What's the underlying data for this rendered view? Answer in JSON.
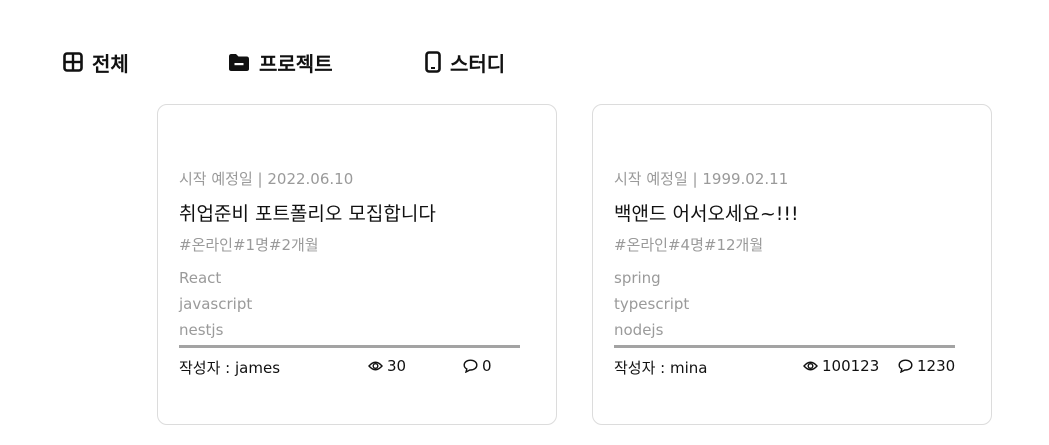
{
  "tabs": [
    {
      "label": "전체",
      "icon": "grid-icon"
    },
    {
      "label": "프로젝트",
      "icon": "folder-icon"
    },
    {
      "label": "스터디",
      "icon": "mobile-icon"
    }
  ],
  "cards": [
    {
      "date": "시작 예정일 | 2022.06.10",
      "title": "취업준비 포트폴리오 모집합니다",
      "tags": "#온라인#1명#2개월",
      "stack": [
        "React",
        "javascript",
        "nestjs"
      ],
      "author": "작성자 : james",
      "views": "30",
      "comments": "0"
    },
    {
      "date": "시작 예정일 | 1999.02.11",
      "title": "백앤드 어서오세요~!!!",
      "tags": "#온라인#4명#12개월",
      "stack": [
        "spring",
        "typescript",
        "nodejs"
      ],
      "author": "작성자 : mina",
      "views": "100123",
      "comments": "1230"
    }
  ],
  "colors": {
    "text": "#111111",
    "muted": "#9a9a9a",
    "border": "#dcdcdc",
    "divider": "#a3a3a3"
  }
}
